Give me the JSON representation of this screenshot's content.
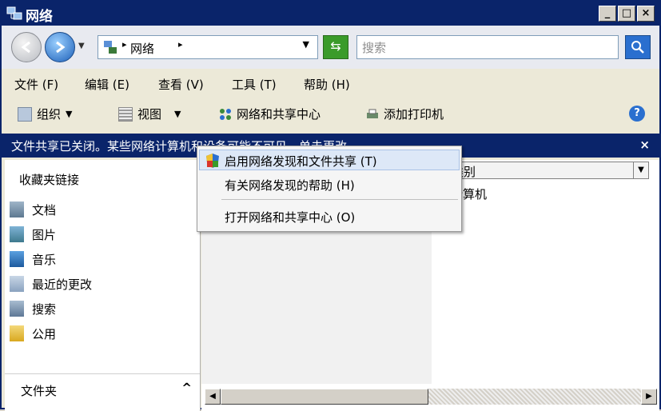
{
  "window": {
    "title": "网络",
    "minimize": "_",
    "maximize": "□",
    "close": "×"
  },
  "address": {
    "path": "网络",
    "arrow": "▸",
    "drop": "▼",
    "search_placeholder": "搜索"
  },
  "menu": [
    "文件 (F)",
    "编辑 (E)",
    "查看 (V)",
    "工具 (T)",
    "帮助 (H)"
  ],
  "toolbar": {
    "organize": "组织",
    "views": "视图",
    "network_center": "网络和共享中心",
    "add_printer": "添加打印机",
    "help": "?"
  },
  "infobar": {
    "text": "文件共享已关闭。某些网络计算机和设备可能不可见。单击更改...",
    "close": "×"
  },
  "left": {
    "heading": "收藏夹链接",
    "items": [
      {
        "label": "文档",
        "icon": "documents-icon"
      },
      {
        "label": "图片",
        "icon": "pictures-icon"
      },
      {
        "label": "音乐",
        "icon": "music-icon"
      },
      {
        "label": "最近的更改",
        "icon": "recent-icon"
      },
      {
        "label": "搜索",
        "icon": "search-icon"
      },
      {
        "label": "公用",
        "icon": "public-folder-icon"
      }
    ],
    "folders_label": "文件夹",
    "folders_arrow": "^"
  },
  "right": {
    "column_header": "类别",
    "cell": "计算机"
  },
  "context_menu": {
    "items": [
      "启用网络发现和文件共享 (T)",
      "有关网络发现的帮助 (H)",
      "打开网络和共享中心 (O)"
    ]
  },
  "colors": {
    "titlebar": "#0a246a",
    "infobar": "#0a246a",
    "menu_hover": "#dde8f7"
  }
}
